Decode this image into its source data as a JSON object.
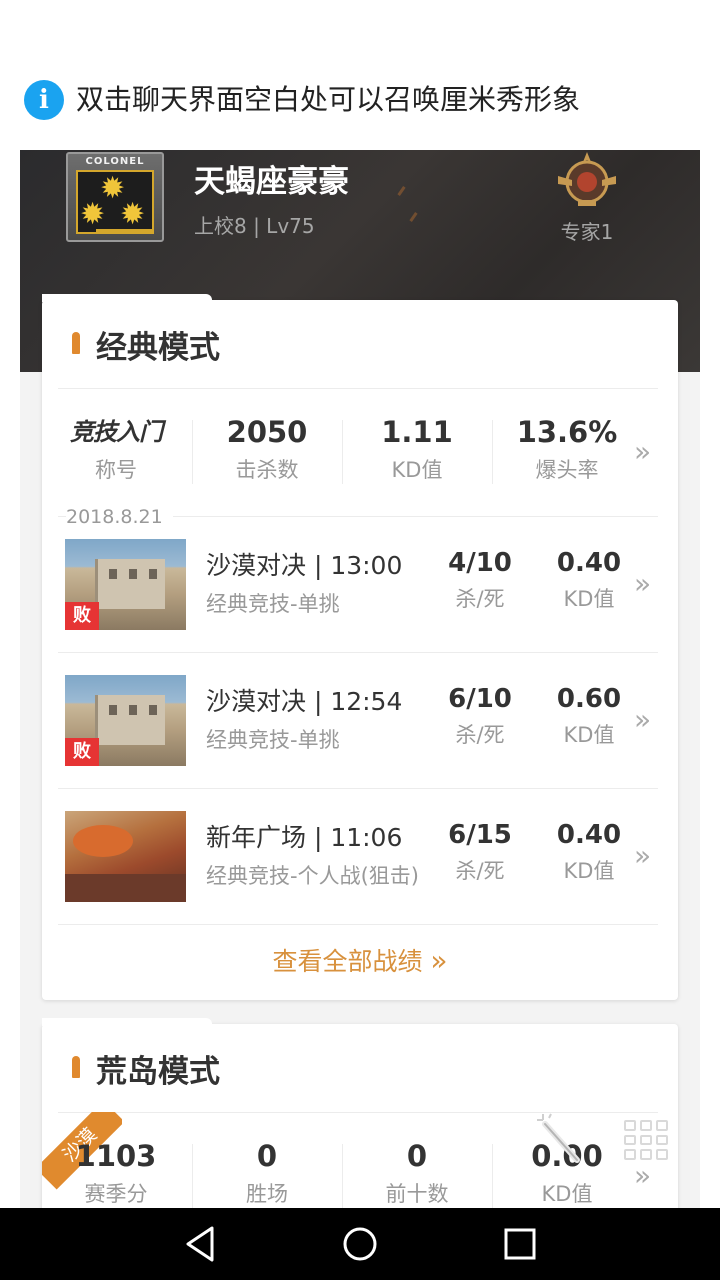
{
  "tip": {
    "text": "双击聊天界面空白处可以召唤厘米秀形象",
    "icon": "info-icon",
    "icon_glyph": "i"
  },
  "profile": {
    "rank_badge_text": "COLONEL",
    "name": "天蝎座豪豪",
    "subtitle": "上校8 | Lv75",
    "expert_label": "专家1"
  },
  "classic": {
    "title": "经典模式",
    "stats": [
      {
        "value": "竞技入门",
        "label": "称号"
      },
      {
        "value": "2050",
        "label": "击杀数"
      },
      {
        "value": "1.11",
        "label": "KD值"
      },
      {
        "value": "13.6%",
        "label": "爆头率"
      }
    ],
    "date": "2018.8.21",
    "matches": [
      {
        "title": "沙漠对决 | 13:00",
        "mode": "经典竞技-单挑",
        "kd_ratio": "4/10",
        "kd_ratio_label": "杀/死",
        "kd": "0.40",
        "kd_label": "KD值",
        "result": "败",
        "map": "desert"
      },
      {
        "title": "沙漠对决 | 12:54",
        "mode": "经典竞技-单挑",
        "kd_ratio": "6/10",
        "kd_ratio_label": "杀/死",
        "kd": "0.60",
        "kd_label": "KD值",
        "result": "败",
        "map": "desert"
      },
      {
        "title": "新年广场 | 11:06",
        "mode": "经典竞技-个人战(狙击)",
        "kd_ratio": "6/15",
        "kd_ratio_label": "杀/死",
        "kd": "0.40",
        "kd_label": "KD值",
        "result": "",
        "map": "newyear"
      }
    ],
    "view_all": "查看全部战绩",
    "view_all_arrow": "»"
  },
  "island": {
    "title": "荒岛模式",
    "ribbon": "沙漠",
    "stats": [
      {
        "value": "1103",
        "label": "赛季分"
      },
      {
        "value": "0",
        "label": "胜场"
      },
      {
        "value": "0",
        "label": "前十数"
      },
      {
        "value": "0.00",
        "label": "KD值"
      }
    ]
  },
  "chevron": "»",
  "colors": {
    "accent": "#e0892e",
    "link": "#d8913d",
    "lose": "#e63434",
    "info": "#1aa3f0"
  }
}
